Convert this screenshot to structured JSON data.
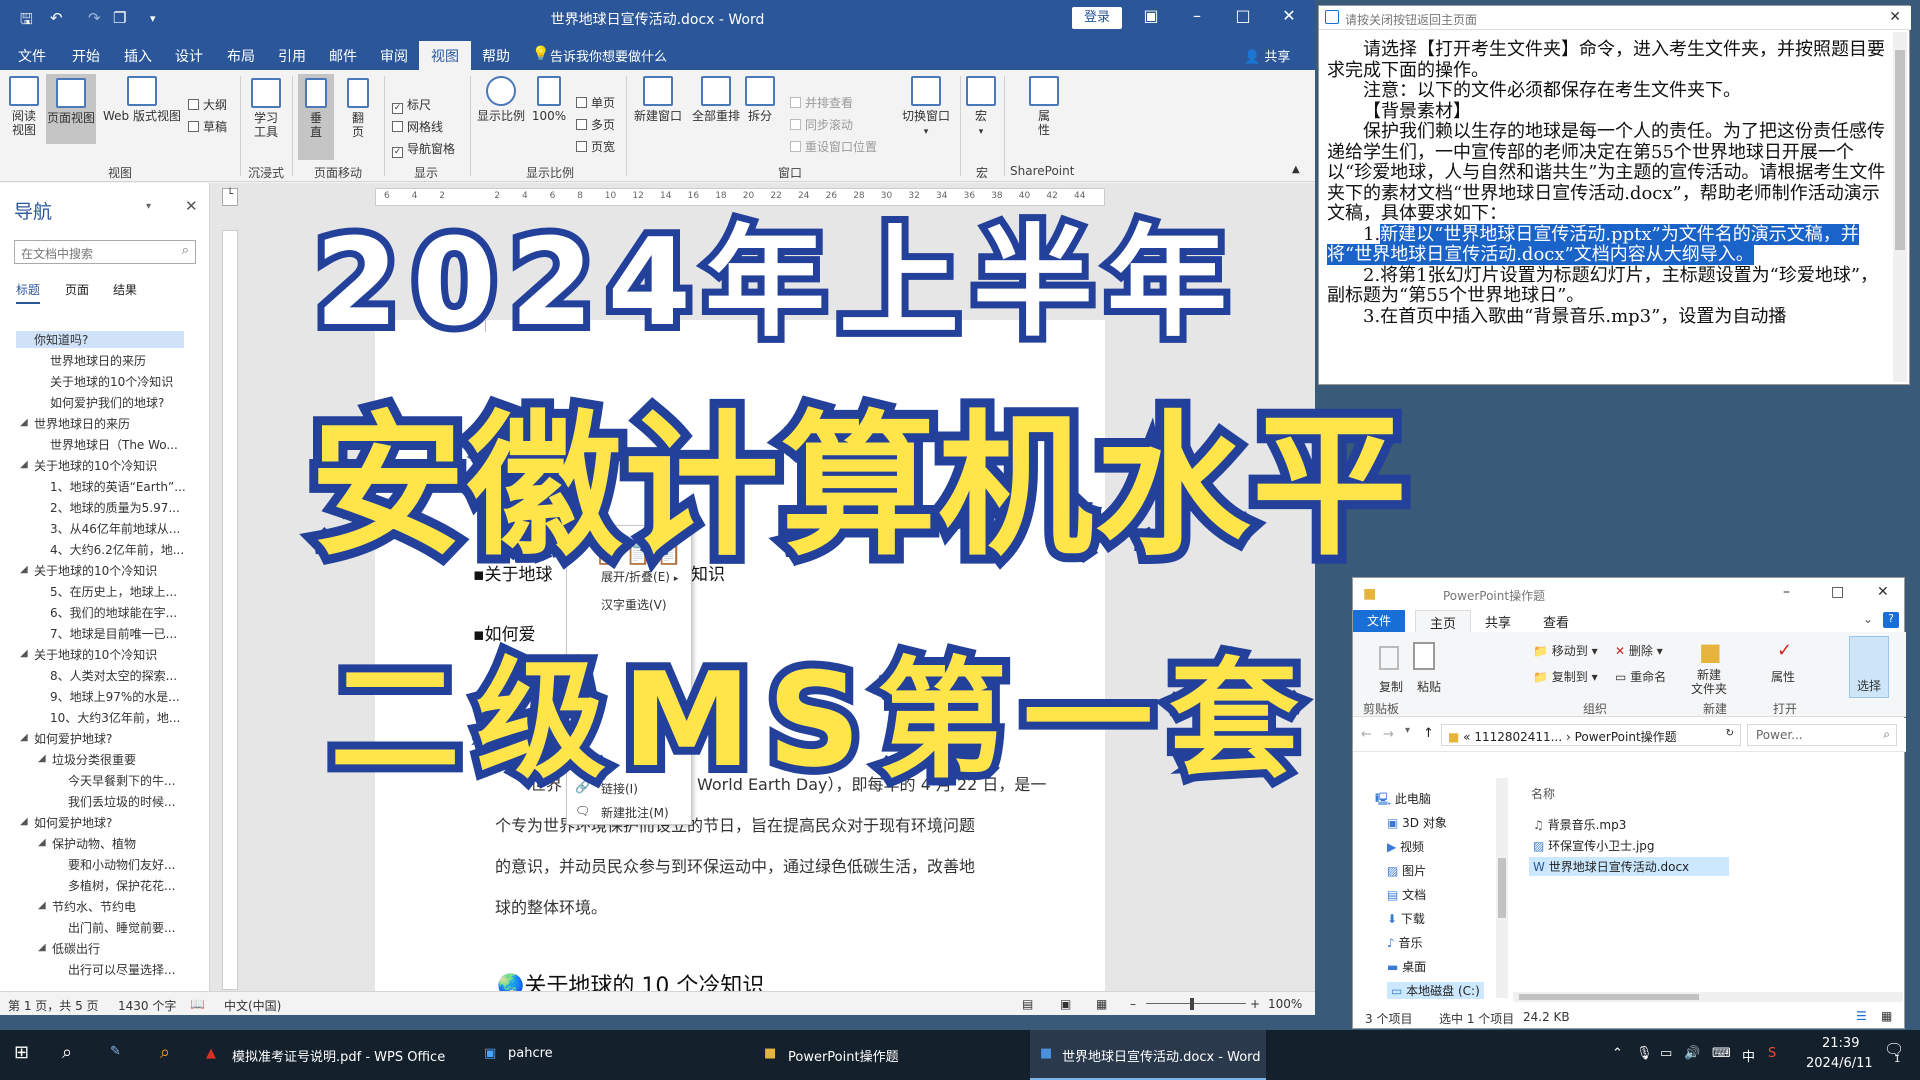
{
  "word": {
    "title": "世界地球日宣传活动.docx - Word",
    "login": "登录",
    "share": "共享",
    "menu": [
      "文件",
      "开始",
      "插入",
      "设计",
      "布局",
      "引用",
      "邮件",
      "审阅",
      "视图",
      "帮助"
    ],
    "tell_me": "告诉我你想要做什么",
    "ribbon": {
      "read_view": "阅读\n视图",
      "page_view": "页面视图",
      "web_view": "Web 版式视图",
      "outline": "大纲",
      "draft": "草稿",
      "group_view": "视图",
      "learning": "学习\n工具",
      "group_immersive": "沉浸式",
      "vertical": "垂\n直",
      "flip": "翻\n页",
      "group_page_move": "页面移动",
      "ruler": "标尺",
      "gridlines": "网格线",
      "nav_pane": "导航窗格",
      "group_show": "显示",
      "zoom": "显示比例",
      "zoom100": "100%",
      "one_page": "单页",
      "multi_page": "多页",
      "page_width": "页宽",
      "group_zoom": "显示比例",
      "new_window": "新建窗口",
      "arrange_all": "全部重排",
      "split": "拆分",
      "side_by_side": "并排查看",
      "sync_scroll": "同步滚动",
      "reset_pos": "重设窗口位置",
      "switch_window": "切换窗口",
      "group_window": "窗口",
      "macro": "宏",
      "group_macro": "宏",
      "properties": "属\n性",
      "group_sharepoint": "SharePoint"
    },
    "nav": {
      "title": "导航",
      "search_placeholder": "在文档中搜索",
      "tabs": [
        "标题",
        "页面",
        "结果"
      ],
      "items": [
        {
          "text": "你知道吗?",
          "level": 1,
          "selected": true
        },
        {
          "text": "世界地球日的来历",
          "level": 2
        },
        {
          "text": "关于地球的10个冷知识",
          "level": 2
        },
        {
          "text": "如何爱护我们的地球?",
          "level": 2
        },
        {
          "text": "世界地球日的来历",
          "level": 1
        },
        {
          "text": "世界地球日（The Wo...",
          "level": 2
        },
        {
          "text": "关于地球的10个冷知识",
          "level": 1
        },
        {
          "text": "1、地球的英语“Earth”...",
          "level": 2
        },
        {
          "text": "2、地球的质量为5.97...",
          "level": 2
        },
        {
          "text": "3、从46亿年前地球从...",
          "level": 2
        },
        {
          "text": "4、大约6.2亿年前，地...",
          "level": 2
        },
        {
          "text": "关于地球的10个冷知识",
          "level": 1
        },
        {
          "text": "5、在历史上，地球上...",
          "level": 2
        },
        {
          "text": "6、我们的地球能在宇...",
          "level": 2
        },
        {
          "text": "7、地球是目前唯一已...",
          "level": 2
        },
        {
          "text": "关于地球的10个冷知识",
          "level": 1
        },
        {
          "text": "8、人类对太空的探索...",
          "level": 2
        },
        {
          "text": "9、地球上97%的水是...",
          "level": 2
        },
        {
          "text": "10、大约3亿年前，地...",
          "level": 2
        },
        {
          "text": "如何爱护地球?",
          "level": 1
        },
        {
          "text": "垃圾分类很重要",
          "level": 2
        },
        {
          "text": "今天早餐剩下的牛...",
          "level": 3
        },
        {
          "text": "我们丢垃圾的时候...",
          "level": 3
        },
        {
          "text": "如何爱护地球?",
          "level": 1
        },
        {
          "text": "保护动物、植物",
          "level": 2
        },
        {
          "text": "要和小动物们友好...",
          "level": 3
        },
        {
          "text": "多植树，保护花花...",
          "level": 3
        },
        {
          "text": "节约水、节约电",
          "level": 2
        },
        {
          "text": "出门前、睡觉前要...",
          "level": 3
        },
        {
          "text": "低碳出行",
          "level": 2
        },
        {
          "text": "出行可以尽量选择...",
          "level": 3
        }
      ]
    },
    "ruler_ticks": [
      "6",
      "4",
      "2",
      "",
      "2",
      "4",
      "6",
      "8",
      "10",
      "12",
      "14",
      "16",
      "18",
      "20",
      "22",
      "24",
      "26",
      "28",
      "30",
      "32",
      "34",
      "36",
      "38",
      "40",
      "42",
      "44"
    ],
    "doc": {
      "line1": "关于地球",
      "line1b": "知识",
      "line2": "如何爱",
      "para_start": "世界",
      "para_mid": "World Earth Day），即每年的 4 月 22 日，是一",
      "para2": "个专为世界环境保护而设立的节日，旨在提高民众对于现有环境问题",
      "para3": "的意识，并动员民众参与到环保运动中，通过绿色低碳生活，改善地",
      "para4": "球的整体环境。",
      "heading": "关于地球的 10 个冷知识"
    },
    "context_menu": {
      "expand": "展开/折叠(E)",
      "hanzi": "汉字重选(V)",
      "link": "链接(I)",
      "new_comment": "新建批注(M)"
    },
    "status": {
      "page": "第 1 页，共 5 页",
      "words": "1430 个字",
      "lang": "中文(中国)",
      "zoom": "100%"
    }
  },
  "notes": {
    "title": "请按关闭按钮返回主页面",
    "p1": "请选择【打开考生文件夹】命令，进入考生文件夹，并按照题目要求完成下面的操作。",
    "p2": "注意：以下的文件必须都保存在考生文件夹下。",
    "p3": "【背景素材】",
    "p4": "保护我们赖以生存的地球是每一个人的责任。为了把这份责任感传递给学生们，一中宣传部的老师决定在第55个世界地球日开展一个以“珍爱地球，人与自然和谐共生”为主题的宣传活动。请根据考生文件夹下的素材文档“世界地球日宣传活动.docx”，帮助老师制作活动演示文稿，具体要求如下：",
    "p5_num": "1.",
    "p5": "新建以“世界地球日宣传活动.pptx”为文件名的演示文稿，并将“世界地球日宣传活动.docx”文档内容从大纲导入。",
    "p6": "2.将第1张幻灯片设置为标题幻灯片，主标题设置为“珍爱地球”，副标题为“第55个世界地球日”。",
    "p7": "3.在首页中插入歌曲“背景音乐.mp3”，设置为自动播"
  },
  "explorer": {
    "title": "PowerPoint操作题",
    "tabs": [
      "文件",
      "主页",
      "共享",
      "查看"
    ],
    "ribbon": {
      "copy": "复制",
      "paste": "粘贴",
      "group_clipboard": "剪贴板",
      "move_to": "移动到",
      "copy_to": "复制到",
      "delete": "删除",
      "rename": "重命名",
      "group_organize": "组织",
      "new_folder": "新建\n文件夹",
      "group_new": "新建",
      "properties": "属性",
      "group_open": "打开",
      "select": "选择"
    },
    "path": [
      "«",
      "1112802411...",
      "PowerPoint操作题"
    ],
    "search_placeholder": "Power...",
    "tree": [
      "此电脑",
      "3D 对象",
      "视频",
      "图片",
      "文档",
      "下载",
      "音乐",
      "桌面",
      "本地磁盘 (C:)"
    ],
    "col_name": "名称",
    "files": [
      "背景音乐.mp3",
      "环保宣传小卫士.jpg",
      "世界地球日宣传活动.docx"
    ],
    "status": {
      "count": "3 个项目",
      "selected": "选中 1 个项目",
      "size": "24.2 KB"
    }
  },
  "taskbar": {
    "items": [
      "模拟准考证号说明.pdf - WPS Office",
      "pahcre",
      "PowerPoint操作题",
      "世界地球日宣传活动.docx - Word"
    ],
    "time": "21:39",
    "date": "2024/6/11",
    "ime": "中",
    "notif": "1"
  },
  "overlay": {
    "line1": "2024年上半年",
    "line2": "安徽计算机水平",
    "line3": "二级MS第一套"
  }
}
